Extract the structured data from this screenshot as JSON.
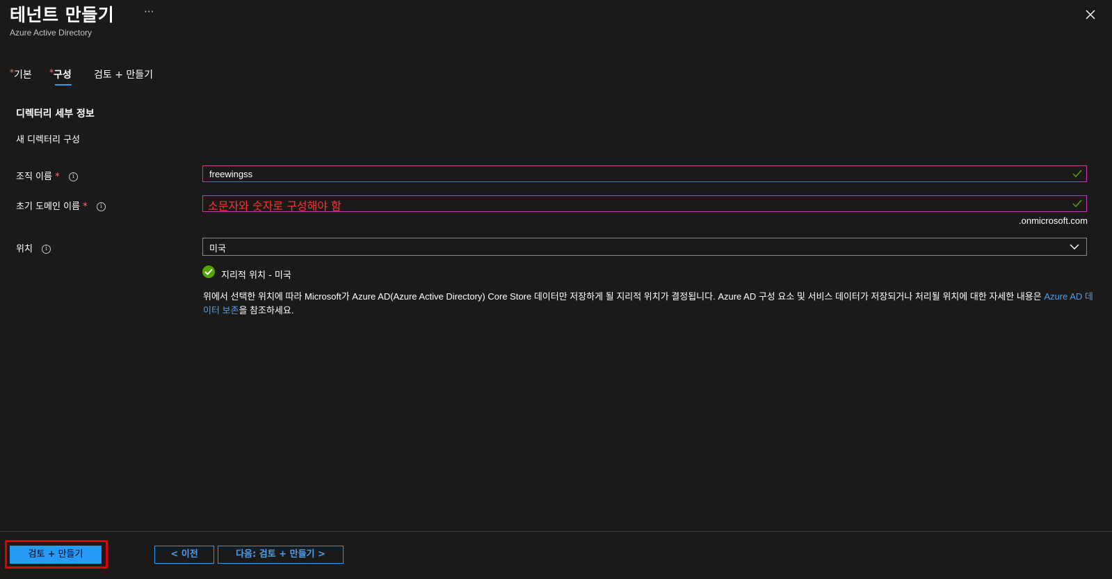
{
  "header": {
    "title": "테넌트 만들기",
    "more": "···",
    "subtitle": "Azure Active Directory"
  },
  "tabs": [
    {
      "required": "*",
      "label": "기본"
    },
    {
      "required": "*",
      "label": "구성"
    },
    {
      "label": "검토 + 만들기"
    }
  ],
  "section": {
    "title": "디렉터리 세부 정보",
    "subtitle": "새 디렉터리 구성"
  },
  "fields": {
    "org_name": {
      "label": "조직 이름",
      "required": "*",
      "value": "freewingss"
    },
    "domain": {
      "label": "초기 도메인 이름",
      "required": "*",
      "overlay_text": "소문자와 숫자로 구성해야 함",
      "suffix": ".onmicrosoft.com"
    },
    "location": {
      "label": "위치",
      "value": "미국"
    }
  },
  "geo": {
    "text": "지리적 위치 - 미국"
  },
  "description": {
    "text1": "위에서 선택한 위치에 따라 Microsoft가 Azure AD(Azure Active Directory) Core Store 데이터만 저장하게 될 지리적 위치가 결정됩니다. Azure AD 구성 요소 및 서비스 데이터가 저장되거나 처리될 위치에 대한 자세한 내용은 ",
    "link": "Azure AD 데이터 보존",
    "text2": "을 참조하세요."
  },
  "footer": {
    "review_create": "검토 + 만들기",
    "previous": "< 이전",
    "next": "다음: 검토 + 만들기 >"
  },
  "colors": {
    "background": "#1b1a19",
    "accent": "#2899f5",
    "field_border": "#c239b3",
    "error_text": "#ff3030",
    "success": "#57a300",
    "highlight": "#e00000"
  }
}
